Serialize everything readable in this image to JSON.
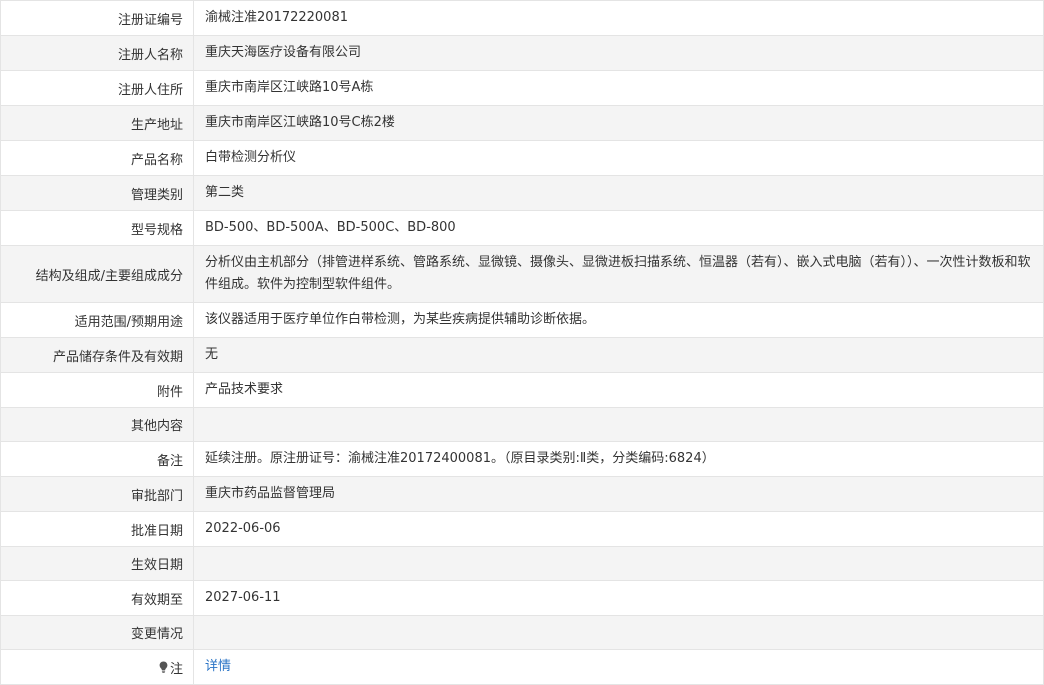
{
  "rows": [
    {
      "label": "注册证编号",
      "value": "渝械注准20172220081"
    },
    {
      "label": "注册人名称",
      "value": "重庆天海医疗设备有限公司"
    },
    {
      "label": "注册人住所",
      "value": "重庆市南岸区江峡路10号A栋"
    },
    {
      "label": "生产地址",
      "value": "重庆市南岸区江峡路10号C栋2楼"
    },
    {
      "label": "产品名称",
      "value": "白带检测分析仪"
    },
    {
      "label": "管理类别",
      "value": "第二类"
    },
    {
      "label": "型号规格",
      "value": "BD-500、BD-500A、BD-500C、BD-800"
    },
    {
      "label": "结构及组成/主要组成成分",
      "value": "分析仪由主机部分（排管进样系统、管路系统、显微镜、摄像头、显微进板扫描系统、恒温器（若有）、嵌入式电脑（若有））、一次性计数板和软件组成。软件为控制型软件组件。"
    },
    {
      "label": "适用范围/预期用途",
      "value": "该仪器适用于医疗单位作白带检测，为某些疾病提供辅助诊断依据。"
    },
    {
      "label": "产品储存条件及有效期",
      "value": "无"
    },
    {
      "label": "附件",
      "value": "产品技术要求"
    },
    {
      "label": "其他内容",
      "value": ""
    },
    {
      "label": "备注",
      "value": "延续注册。原注册证号：渝械注准20172400081。（原目录类别:Ⅱ类，分类编码:6824）"
    },
    {
      "label": "审批部门",
      "value": "重庆市药品监督管理局"
    },
    {
      "label": "批准日期",
      "value": "2022-06-06"
    },
    {
      "label": "生效日期",
      "value": ""
    },
    {
      "label": "有效期至",
      "value": "2027-06-11"
    },
    {
      "label": "变更情况",
      "value": ""
    }
  ],
  "note": {
    "label": "注",
    "link": "详情",
    "icon": "lightbulb-icon"
  }
}
